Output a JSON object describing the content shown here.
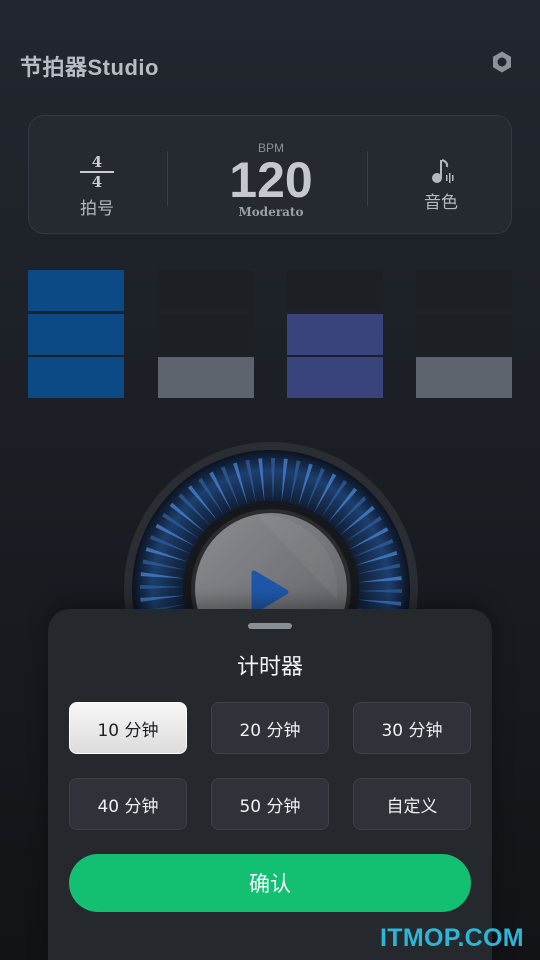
{
  "header": {
    "app_title": "节拍器Studio",
    "settings_icon": "gear-icon"
  },
  "meter": {
    "time_signature_top": "4",
    "time_signature_bottom": "4",
    "time_signature_label": "拍号",
    "bpm_label": "BPM",
    "bpm_value": "120",
    "tempo_name": "Moderato",
    "sound_icon": "music-note-icon",
    "sound_label": "音色"
  },
  "beats": [
    {
      "levels": [
        "#0c4a86",
        "#0c4a86",
        "#0c4a86"
      ]
    },
    {
      "levels": [
        "#1c1f24",
        "#1c1f24",
        "#5d646e"
      ]
    },
    {
      "levels": [
        "#1c1f24",
        "#3a447c",
        "#3a447c"
      ]
    },
    {
      "levels": [
        "#1c1f24",
        "#1c1f24",
        "#5d646e"
      ]
    }
  ],
  "player": {
    "play_icon": "play-icon",
    "accent": "#1f57a8"
  },
  "timer_sheet": {
    "title": "计时器",
    "options": [
      "10 分钟",
      "20 分钟",
      "30 分钟",
      "40 分钟",
      "50 分钟",
      "自定义"
    ],
    "selected_option": "10 分钟",
    "confirm_label": "确认",
    "confirm_color": "#13bf70"
  },
  "watermark": "ITMOP.COM"
}
